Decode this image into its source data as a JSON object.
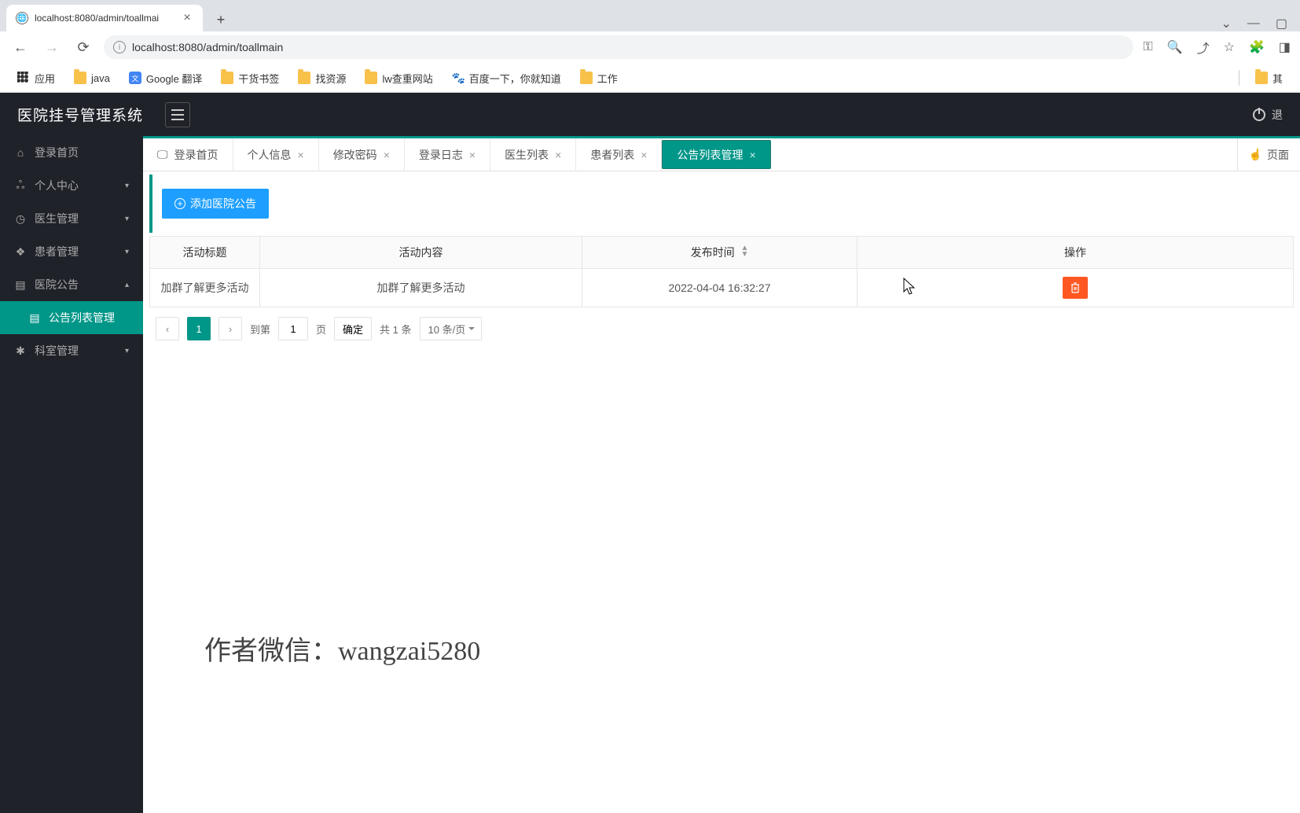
{
  "browser": {
    "tab_title": "localhost:8080/admin/toallmai",
    "url": "localhost:8080/admin/toallmain",
    "new_tab": "+",
    "bookmarks": {
      "apps": "应用",
      "items": [
        "java",
        "Google 翻译",
        "干货书签",
        "找资源",
        "lw查重网站",
        "百度一下，你就知道",
        "工作"
      ],
      "overflow": "其"
    }
  },
  "app": {
    "title": "医院挂号管理系统",
    "logout_hint": "退"
  },
  "sidebar": {
    "items": [
      {
        "label": "登录首页",
        "icon": "⌂"
      },
      {
        "label": "个人中心",
        "icon": "ஃ",
        "chev": "▾"
      },
      {
        "label": "医生管理",
        "icon": "◷",
        "chev": "▾"
      },
      {
        "label": "患者管理",
        "icon": "❖",
        "chev": "▾"
      },
      {
        "label": "医院公告",
        "icon": "▤",
        "chev": "▴"
      },
      {
        "label": "公告列表管理",
        "icon": "▤",
        "sub": true,
        "active": true
      },
      {
        "label": "科室管理",
        "icon": "✱",
        "chev": "▾"
      }
    ]
  },
  "tabs": {
    "items": [
      {
        "label": "登录首页",
        "home": true
      },
      {
        "label": "个人信息"
      },
      {
        "label": "修改密码"
      },
      {
        "label": "登录日志"
      },
      {
        "label": "医生列表"
      },
      {
        "label": "患者列表"
      },
      {
        "label": "公告列表管理",
        "active": true
      }
    ],
    "page_ops": "页面"
  },
  "toolbar": {
    "add_label": "添加医院公告"
  },
  "table": {
    "headers": {
      "title": "活动标题",
      "content": "活动内容",
      "time": "发布时间",
      "action": "操作"
    },
    "rows": [
      {
        "title": "加群了解更多活动",
        "content": "加群了解更多活动",
        "time": "2022-04-04 16:32:27"
      }
    ]
  },
  "pagination": {
    "current": "1",
    "goto_prefix": "到第",
    "goto_value": "1",
    "goto_suffix": "页",
    "confirm": "确定",
    "total": "共 1 条",
    "page_size": "10 条/页"
  },
  "watermark": "作者微信：wangzai5280"
}
